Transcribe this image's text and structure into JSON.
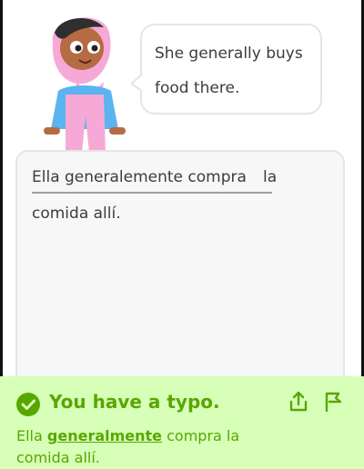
{
  "prompt": {
    "bubble_line1": "She generally buys",
    "bubble_line2": "food there."
  },
  "answer": {
    "words": [
      "Ella generalemente compra",
      "la",
      "comida allí."
    ]
  },
  "feedback": {
    "title": "You have a typo.",
    "text_before": "Ella ",
    "highlight": "generalmente",
    "text_after1": " compra la",
    "text_line2": "comida allí.",
    "share_icon": "share-icon",
    "report_icon": "flag-icon",
    "status_color": "#58a700",
    "bg_color": "#d7ffb8"
  }
}
